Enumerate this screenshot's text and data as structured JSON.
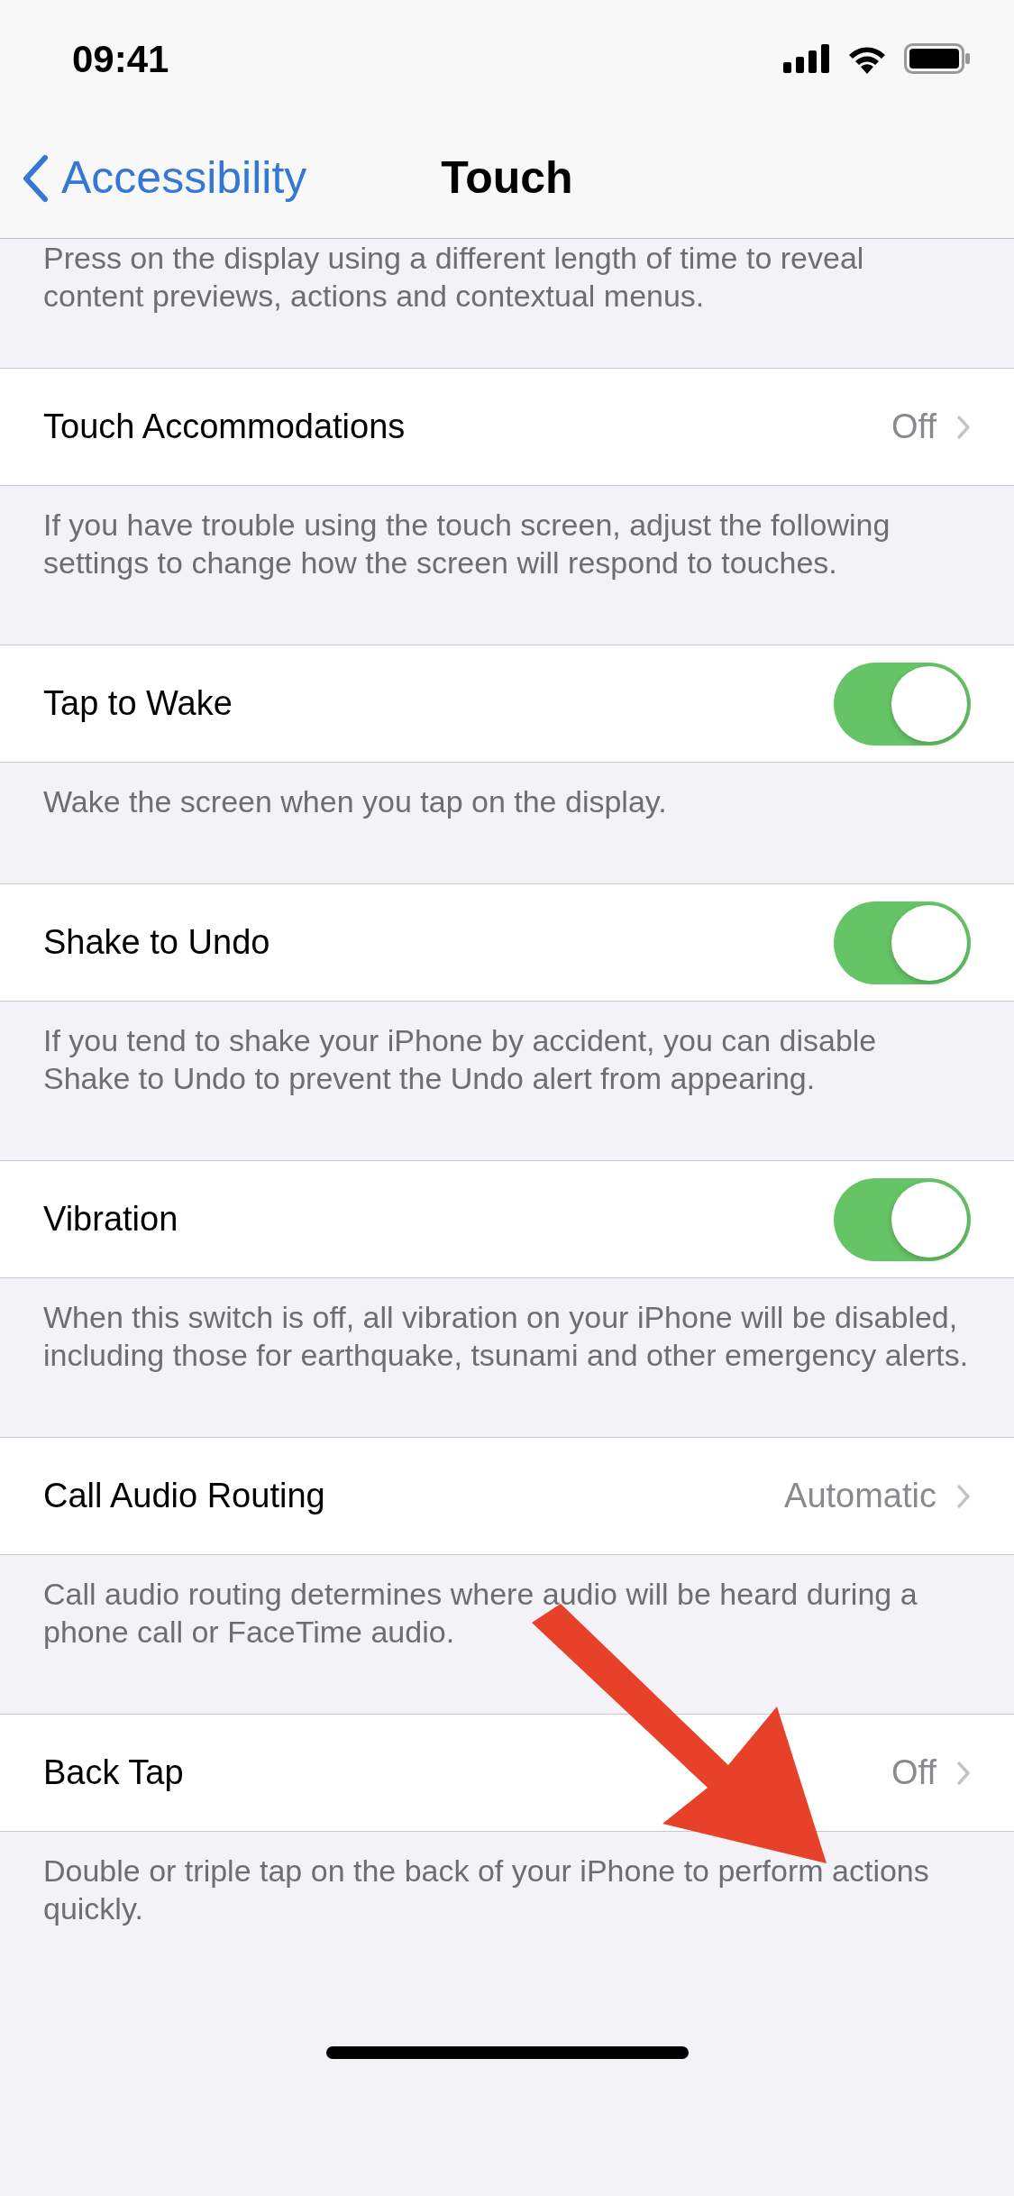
{
  "status_bar": {
    "time": "09:41"
  },
  "nav": {
    "back": "Accessibility",
    "title": "Touch"
  },
  "top_note": "Press on the display using a different length of time to reveal content previews, actions and contextual menus.",
  "rows": [
    {
      "label": "Touch Accommodations",
      "kind": "value",
      "value": "Off",
      "footer": "If you have trouble using the touch screen, adjust the following settings to change how the screen will respond to touches."
    },
    {
      "label": "Tap to Wake",
      "kind": "switch",
      "on": true,
      "footer": "Wake the screen when you tap on the display."
    },
    {
      "label": "Shake to Undo",
      "kind": "switch",
      "on": true,
      "footer": "If you tend to shake your iPhone by accident, you can disable Shake to Undo to prevent the Undo alert from appearing."
    },
    {
      "label": "Vibration",
      "kind": "switch",
      "on": true,
      "footer": "When this switch is off, all vibration on your iPhone will be disabled, including those for earthquake, tsunami and other emergency alerts."
    },
    {
      "label": "Call Audio Routing",
      "kind": "value",
      "value": "Automatic",
      "footer": "Call audio routing determines where audio will be heard during a phone call or FaceTime audio."
    },
    {
      "label": "Back Tap",
      "kind": "value",
      "value": "Off",
      "footer": "Double or triple tap on the back of your iPhone to perform actions quickly."
    }
  ]
}
